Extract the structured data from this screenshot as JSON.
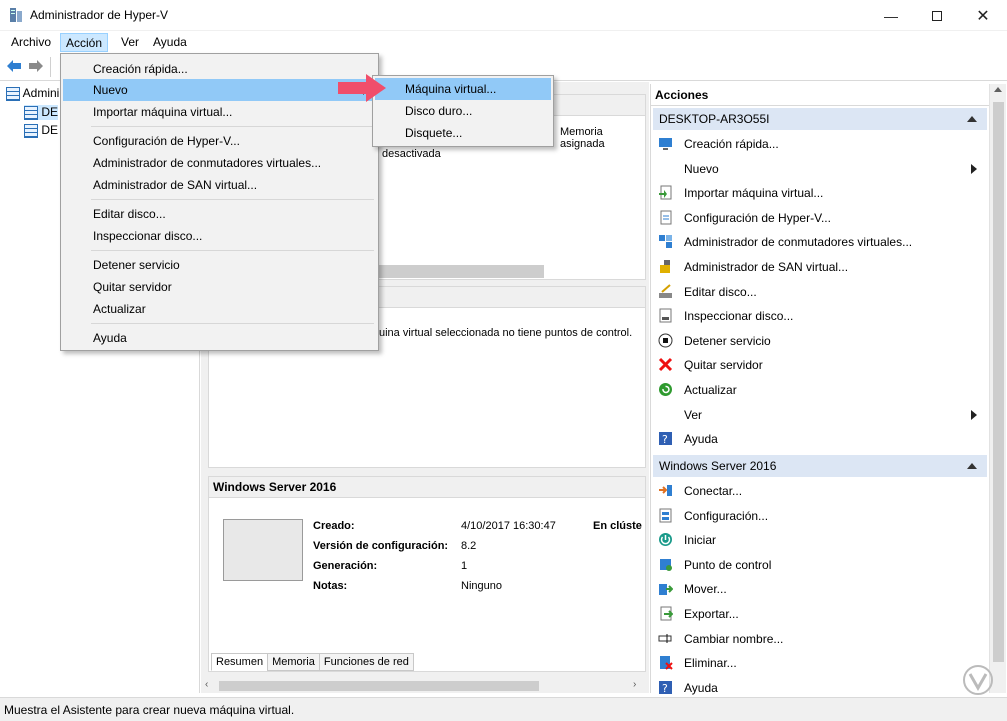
{
  "window": {
    "title": "Administrador de Hyper-V"
  },
  "menubar": {
    "items": [
      "Archivo",
      "Acción",
      "Ver",
      "Ayuda"
    ]
  },
  "tree": {
    "root": "Administrador de Hyper-V",
    "servers": [
      "DESKTOP-AR3O55I",
      "DESKTOP-AR3O55I"
    ],
    "root_visible": "Admini",
    "server_visible": "DE"
  },
  "accion_menu": {
    "items": [
      "Creación rápida...",
      "Nuevo",
      "Importar máquina virtual...",
      "Configuración de Hyper-V...",
      "Administrador de conmutadores virtuales...",
      "Administrador de SAN virtual...",
      "Editar disco...",
      "Inspeccionar disco...",
      "Detener servicio",
      "Quitar servidor",
      "Actualizar",
      "Ayuda"
    ]
  },
  "nuevo_submenu": {
    "items": [
      "Máquina virtual...",
      "Disco duro...",
      "Disquete..."
    ]
  },
  "middle": {
    "vm_list_partial": {
      "memory_header": "Memoria asignada",
      "state_text": "desactivada"
    },
    "checkpoints_text": "uina virtual seleccionada no tiene puntos de control.",
    "details": {
      "title": "Windows Server 2016",
      "fields": [
        {
          "label": "Creado:",
          "value": "4/10/2017 16:30:47"
        },
        {
          "label": "Versión de configuración:",
          "value": "8.2"
        },
        {
          "label": "Generación:",
          "value": "1"
        },
        {
          "label": "Notas:",
          "value": "Ninguno"
        }
      ],
      "cluster_label": "En clúste",
      "tabs": [
        "Resumen",
        "Memoria",
        "Funciones de red"
      ]
    }
  },
  "actions": {
    "header": "Acciones",
    "host_section": {
      "title": "DESKTOP-AR3O55I",
      "items": [
        {
          "label": "Creación rápida...",
          "icon": "quick-create-icon"
        },
        {
          "label": "Nuevo",
          "icon": "none",
          "submenu": true
        },
        {
          "label": "Importar máquina virtual...",
          "icon": "import-icon"
        },
        {
          "label": "Configuración de Hyper-V...",
          "icon": "settings-doc-icon"
        },
        {
          "label": "Administrador de conmutadores virtuales...",
          "icon": "switch-icon"
        },
        {
          "label": "Administrador de SAN virtual...",
          "icon": "san-icon"
        },
        {
          "label": "Editar disco...",
          "icon": "edit-disk-icon"
        },
        {
          "label": "Inspeccionar disco...",
          "icon": "inspect-disk-icon"
        },
        {
          "label": "Detener servicio",
          "icon": "stop-icon"
        },
        {
          "label": "Quitar servidor",
          "icon": "remove-icon"
        },
        {
          "label": "Actualizar",
          "icon": "refresh-icon"
        },
        {
          "label": "Ver",
          "icon": "none",
          "submenu": true
        },
        {
          "label": "Ayuda",
          "icon": "help-icon"
        }
      ]
    },
    "vm_section": {
      "title": "Windows Server 2016",
      "items": [
        {
          "label": "Conectar...",
          "icon": "connect-icon"
        },
        {
          "label": "Configuración...",
          "icon": "config-icon"
        },
        {
          "label": "Iniciar",
          "icon": "start-icon"
        },
        {
          "label": "Punto de control",
          "icon": "checkpoint-icon"
        },
        {
          "label": "Mover...",
          "icon": "move-icon"
        },
        {
          "label": "Exportar...",
          "icon": "export-icon"
        },
        {
          "label": "Cambiar nombre...",
          "icon": "rename-icon"
        },
        {
          "label": "Eliminar...",
          "icon": "delete-icon"
        },
        {
          "label": "Ayuda",
          "icon": "help-icon"
        }
      ]
    }
  },
  "statusbar": {
    "text": "Muestra el Asistente para crear nueva máquina virtual."
  },
  "colors": {
    "accent": "#91c9f7",
    "section": "#dce6f4",
    "arrow": "#f04e6b"
  }
}
